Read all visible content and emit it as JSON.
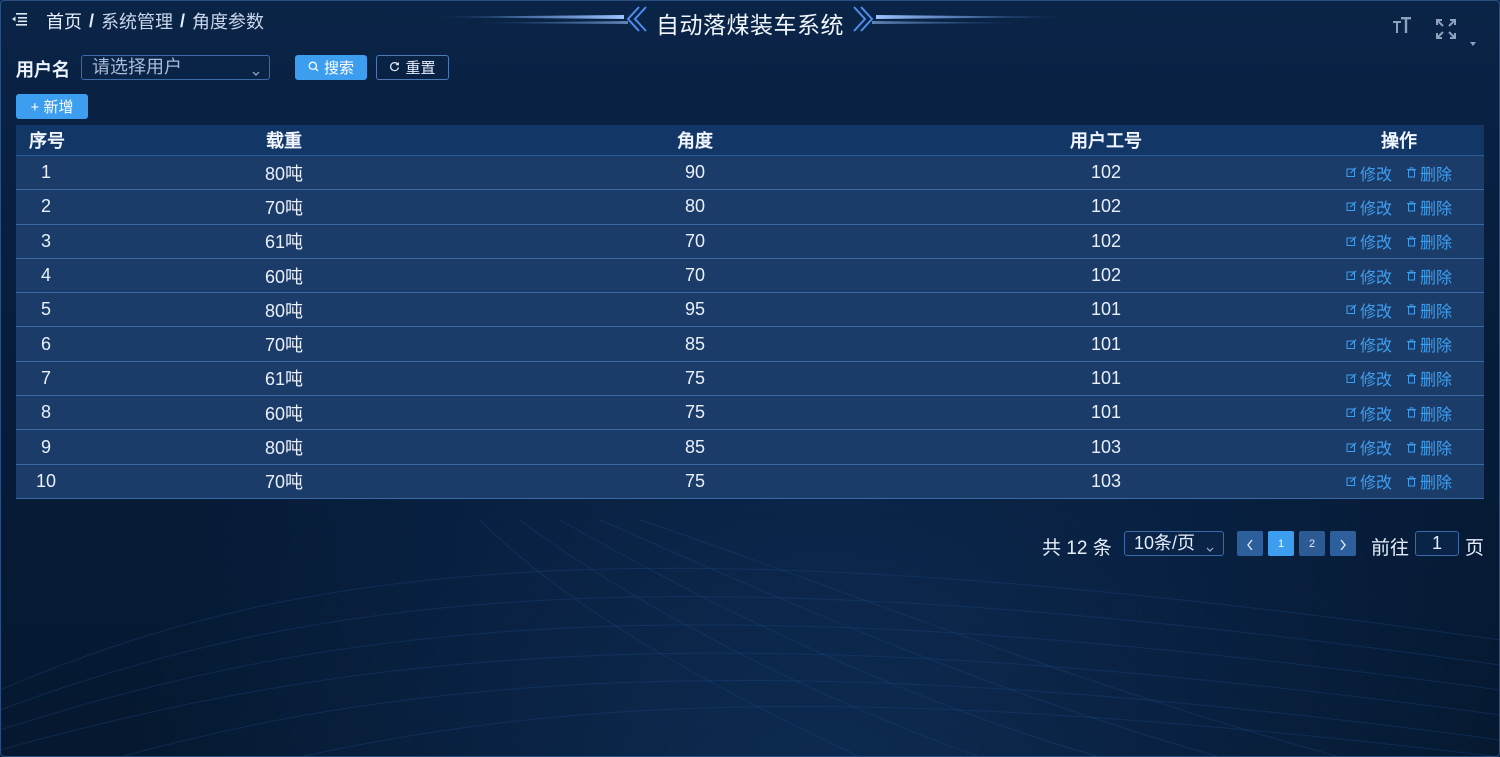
{
  "header": {
    "breadcrumb": [
      "首页",
      "系统管理",
      "角度参数"
    ],
    "breadcrumb_sep": "/",
    "title": "自动落煤装车系统"
  },
  "filter": {
    "user_label": "用户名",
    "user_placeholder": "请选择用户",
    "search_label": "搜索",
    "reset_label": "重置"
  },
  "toolbar": {
    "add_label": "+ 新增"
  },
  "table": {
    "columns": [
      "序号",
      "载重",
      "角度",
      "用户工号",
      "操作"
    ],
    "rows": [
      {
        "index": "1",
        "load": "80吨",
        "angle": "90",
        "user_id": "102"
      },
      {
        "index": "2",
        "load": "70吨",
        "angle": "80",
        "user_id": "102"
      },
      {
        "index": "3",
        "load": "61吨",
        "angle": "70",
        "user_id": "102"
      },
      {
        "index": "4",
        "load": "60吨",
        "angle": "70",
        "user_id": "102"
      },
      {
        "index": "5",
        "load": "80吨",
        "angle": "95",
        "user_id": "101"
      },
      {
        "index": "6",
        "load": "70吨",
        "angle": "85",
        "user_id": "101"
      },
      {
        "index": "7",
        "load": "61吨",
        "angle": "75",
        "user_id": "101"
      },
      {
        "index": "8",
        "load": "60吨",
        "angle": "75",
        "user_id": "101"
      },
      {
        "index": "9",
        "load": "80吨",
        "angle": "85",
        "user_id": "103"
      },
      {
        "index": "10",
        "load": "70吨",
        "angle": "75",
        "user_id": "103"
      }
    ],
    "edit_label": "修改",
    "delete_label": "删除"
  },
  "pagination": {
    "total_text": "共 12 条",
    "page_size": "10条/页",
    "pages": [
      "1",
      "2"
    ],
    "current_page": "1",
    "goto_prefix": "前往",
    "goto_value": "1",
    "goto_suffix": "页"
  },
  "colors": {
    "background": "#061c3a",
    "accent": "#3d9eef",
    "row": "#1b3c68",
    "header_row": "#123666"
  },
  "icons": [
    "menu-fold-icon",
    "font-size-icon",
    "fullscreen-icon",
    "search-icon",
    "refresh-icon",
    "edit-icon",
    "trash-icon",
    "chevron-down-icon",
    "chevron-left-icon",
    "chevron-right-icon"
  ]
}
